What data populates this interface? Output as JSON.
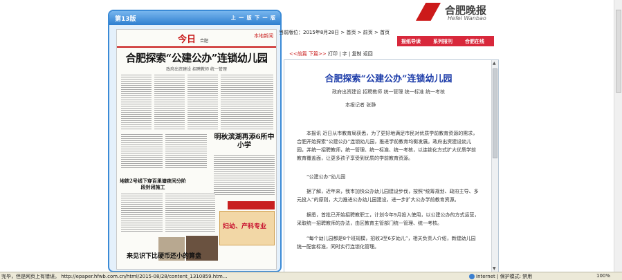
{
  "panel": {
    "edition_label": "第13版",
    "nav_text": "上 一 版   下 一 版"
  },
  "thumbnail": {
    "logo": "今日",
    "page_label": "合肥",
    "page_name": "本地新闻",
    "headline": "合肥探索“公建公办”连锁幼儿园",
    "subhead": "政府出资建设 招聘教师 统一管理",
    "side_head": "明秋滨湖再添6所中小学",
    "left_head": "地铁2号线下穿百里塘夜间分阶段封闭施工",
    "ad_text": "妇幼、产科专业",
    "bottom_head": "来见识下比硬币还小的算盘"
  },
  "logo": {
    "cn": "合肥晚报",
    "en": "Hefei Wanbao"
  },
  "breadcrumb": "当前版位：2015年8月28日 > 首页 > 前页 > 首页",
  "nav": {
    "buttons": [
      "报纸导读",
      "系列报刊",
      "合肥在线"
    ]
  },
  "article_tools": {
    "prev": "<<前篇",
    "next": "下篇>>",
    "rest": "打印  | 字 | 复制  返回"
  },
  "article": {
    "title": "合肥探索“公建公办”连锁幼儿园",
    "subtitle": "政府出资建设 招聘教师 统一管理 统一标准 统一考核",
    "byline": "本报记者 张静",
    "para1": "本报讯 近日从市教育局获悉，为了更好地满足市民对优质学前教育资源的需求，合肥开始探索“公建公办”连锁幼儿园，推进学前教育均衡发展。政府出资建设幼儿园，并统一招聘教师，统一管理、统一标准、统一考核，以连锁化方式扩大优质学前教育覆盖面，让更多孩子享受到优质的学前教育资源。",
    "section1": "“公建公办”幼儿园",
    "para2": "据了解，近年来，我市加快公办幼儿园建设步伐，按照“统筹规划、政府主导、多元投入”的原则，大力推进公办幼儿园建设，进一步扩大公办学前教育资源。",
    "para3": "据悉，首批已开始招聘教职工，计划今年9月投入使用，以公建公办的方式运营，采取统一招聘教师的办法，由区教育主管部门统一管理、统一考核。",
    "para4": "“每个幼儿园都是8个班规模，招收3至6岁幼儿”，相关负责人介绍，新建幼儿园统一配套标准，同时实行连锁化管理。"
  },
  "status": {
    "left": "完毕，但是网页上有错误。 http://epaper.hfwb.com.cn/html/2015-08/28/content_1310859.htm...",
    "zone": "Internet | 保护模式: 禁用",
    "zoom": "100%"
  }
}
